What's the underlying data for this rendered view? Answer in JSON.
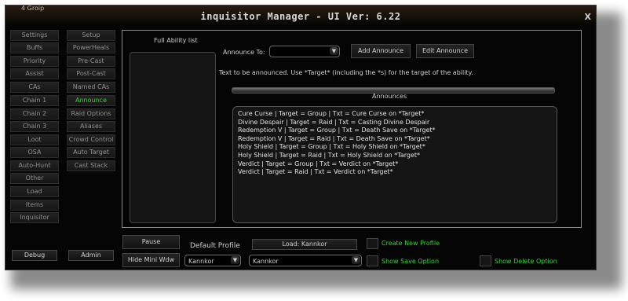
{
  "window": {
    "corner_text": "4 Groip",
    "title": "inquisitor Manager  - UI Ver: 6.22",
    "close": "X"
  },
  "sidebar": {
    "col1": [
      "Settings",
      "Buffs",
      "Priority",
      "Assist",
      "CAs",
      "Chain 1",
      "Chain 2",
      "Chain 3",
      "Loot",
      "OSA",
      "Auto-Hunt",
      "Other",
      "Load",
      "Items",
      "Inquisitor"
    ],
    "col2": [
      "Setup",
      "PowerHeals",
      "Pre-Cast",
      "Post-Cast",
      "Named CAs",
      "Announce",
      "Raid Options",
      "Aliases",
      "Crowd Control",
      "Auto Target",
      "Cast Stack"
    ],
    "active": "Announce"
  },
  "bottom": {
    "debug": "Debug",
    "admin": "Admin",
    "pause": "Pause",
    "hide_mini": "Hide Mini Wdw",
    "default_profile_label": "Default Profile",
    "load_button": "Load: Kannkor",
    "profile_select": "Kannkor",
    "profile_select2": "Kannkor",
    "create_new_profile": "Create New Profile",
    "show_save_option": "Show Save Option",
    "show_delete_option": "Show Delete Option"
  },
  "announce": {
    "full_ability_list": "Full Ability list",
    "announce_to_label": "Announce To:",
    "announce_to_value": "",
    "add_button": "Add Announce",
    "edit_button": "Edit Announce",
    "hint": "Text to be announced. Use *Target* (including the *s) for the target of the ability.",
    "list_header": "Announces",
    "items": [
      "Cure Curse | Target = Group | Txt = Cure Curse on *Target*",
      "Divine Despair | Target = Raid | Txt = Casting Divine Despair",
      "Redemption V | Target = Group | Txt = Death Save on *Target*",
      "Redemption V | Target = Raid | Txt = Death Save on *Target*",
      "Holy Shield | Target = Group | Txt = Holy Shield on *Target*",
      "Holy Shield | Target = Raid | Txt = Holy Shield on *Target*",
      "Verdict | Target = Group | Txt = Verdict on *Target*",
      "Verdict | Target = Raid | Txt = Verdict on *Target*"
    ]
  },
  "colors": {
    "accent_green": "#37d637",
    "background": "#050505",
    "text": "#d0d0d0"
  }
}
